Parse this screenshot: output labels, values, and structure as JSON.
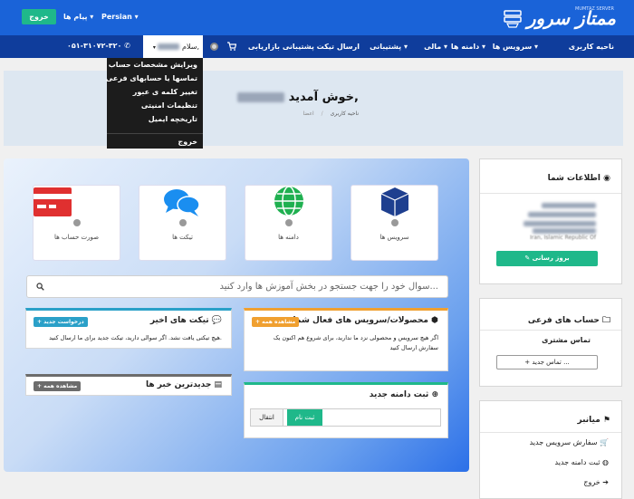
{
  "topbar": {
    "logout_label": "خروج",
    "messages_label": "پیام ها ▾",
    "language_label": "Persian ▾",
    "logo_text": "ممتاز سرور",
    "logo_sub": "MUMTAZ SERVER"
  },
  "nav": {
    "items": [
      {
        "label": "ناحیه کاربری"
      },
      {
        "label": "سرویس ها ▾"
      },
      {
        "label": "دامنه ها ▾"
      },
      {
        "label": "مالی ▾"
      },
      {
        "label": "پشتیبانی ▾"
      },
      {
        "label": "ارسال تیکت پشتیبانی"
      },
      {
        "label": "بازاریابی"
      }
    ],
    "phone": "۰۵۱-۳۱۰۷۲-۳۲۰",
    "user_greeting": "سلام,"
  },
  "dropdown": {
    "items": [
      {
        "label": "ویرایش مشخصات حساب"
      },
      {
        "label": "تماسها یا حسابهای فرعی"
      },
      {
        "label": "تغییر کلمه ی عبور"
      },
      {
        "label": "تنظیمات امنیتی"
      },
      {
        "label": "تاریخچه ایمیل"
      },
      {
        "label": "خروج"
      }
    ]
  },
  "banner": {
    "title": "خوش آمدید,",
    "breadcrumb_home": "اعضا",
    "breadcrumb_sep": "/",
    "breadcrumb_current": "ناحیه کاربری"
  },
  "info_card": {
    "title": "اطلاعات شما",
    "address_last_line": "Iran, Islamic Republic Of",
    "update_label": "بروز رسانی"
  },
  "subaccounts_card": {
    "title": "حساب های فرعی",
    "contact_label": "تماس مشتری",
    "new_contact_label": "تماس جدید ..."
  },
  "shortcuts_card": {
    "title": "میانبر",
    "items": [
      {
        "label": "سفارش سرویس جدید"
      },
      {
        "label": "ثبت دامنه جدید"
      },
      {
        "label": "خروج"
      }
    ]
  },
  "tiles": [
    {
      "label": "سرویس ها"
    },
    {
      "label": "دامنه ها"
    },
    {
      "label": "تیکت ها"
    },
    {
      "label": "صورت حساب ها"
    }
  ],
  "search": {
    "placeholder": "سوال خود را جهت جستجو در بخش آموزش ها وارد کنید..."
  },
  "products_card": {
    "title": "محصولات/سرویس های فعال شما",
    "badge": "+ مشاهده همه",
    "body": "اگر هیچ سرویس و محصولی نزد ما ندارید، برای شروع هم اکنون یک سفارش ارسال کنید"
  },
  "tickets_card": {
    "title": "تیکت های اخیر",
    "badge": "+ درخواست جدید",
    "body": "هیچ تیکتی یافت نشد. اگر سوالی دارید، تیکت جدید برای ما ارسال کنید."
  },
  "news_card": {
    "title": "جدیدترین خبر ها",
    "badge": "+ مشاهده همه"
  },
  "domain_card": {
    "title": "ثبت دامنه جدید",
    "register_label": "ثبت نام",
    "transfer_label": "انتقال"
  },
  "colors": {
    "topbar": "#1a63d8",
    "navbar": "#0f3d9c",
    "accent_green": "#1fb88a",
    "badge_orange": "#f0a030",
    "badge_teal": "#2aa0c8",
    "badge_grey": "#6c6c6c",
    "tile_icon_blue": "#1e3f8f",
    "tile_icon_green": "#1fb050",
    "tile_icon_lightblue": "#1a8ef0",
    "tile_icon_red": "#e03030"
  }
}
